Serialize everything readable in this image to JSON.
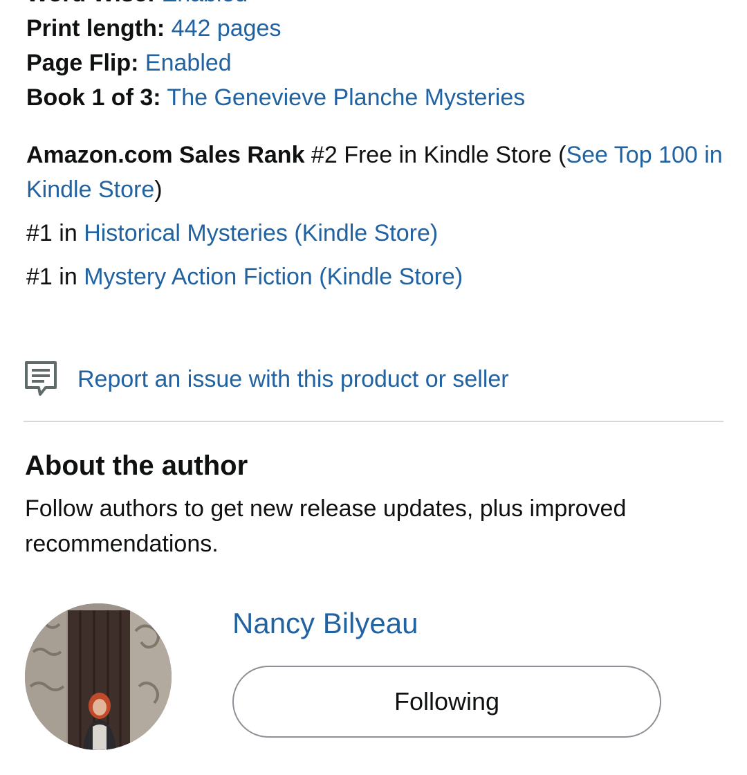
{
  "details": {
    "word_wise": {
      "label": "Word Wise:",
      "value": "Enabled"
    },
    "print_length": {
      "label": "Print length:",
      "value": "442 pages"
    },
    "page_flip": {
      "label": "Page Flip:",
      "value": "Enabled"
    },
    "series": {
      "label": "Book 1 of 3:",
      "value": "The Genevieve Planche Mysteries"
    }
  },
  "sales_rank": {
    "label": "Amazon.com Sales Rank",
    "text": " #2 Free in Kindle Store (",
    "link": "See Top 100 in Kindle Store",
    "close": ")"
  },
  "sub_ranks": [
    {
      "rank": "#1 in ",
      "category": "Historical Mysteries (Kindle Store)"
    },
    {
      "rank": "#1 in ",
      "category": "Mystery Action Fiction (Kindle Store)"
    }
  ],
  "report": {
    "icon": "feedback-icon",
    "label": "Report an issue with this product or seller"
  },
  "about_author": {
    "heading": "About the author",
    "subtitle": "Follow authors to get new release updates, plus improved recommendations.",
    "author_name": "Nancy Bilyeau",
    "follow_button": "Following"
  },
  "colors": {
    "link": "#2162a1",
    "text": "#0f1111",
    "divider": "#d5d9d9",
    "button_border": "#8d9096"
  }
}
